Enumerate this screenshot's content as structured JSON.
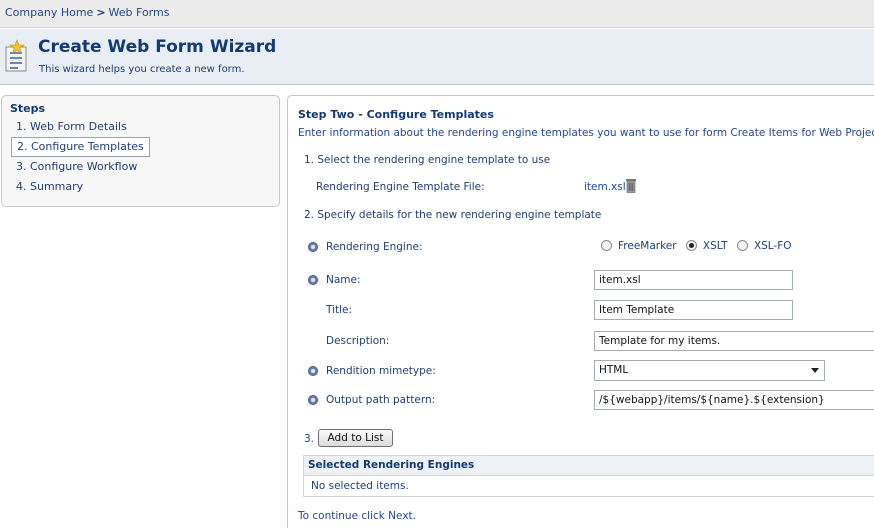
{
  "breadcrumb": {
    "home": "Company Home",
    "separator": ">",
    "current": "Web Forms"
  },
  "header": {
    "icon": "wizard-form-icon",
    "title": "Create Web Form Wizard",
    "subtitle": "This wizard helps you create a new form."
  },
  "steps": {
    "title": "Steps",
    "items": [
      {
        "label": "1. Web Form Details"
      },
      {
        "label": "2. Configure Templates"
      },
      {
        "label": "3. Configure Workflow"
      },
      {
        "label": "4. Summary"
      }
    ],
    "active_index": 1
  },
  "main": {
    "heading": "Step Two - Configure Templates",
    "intro": "Enter information about the rendering engine templates you want to use for form Create Items for Web Project.",
    "section1": "1. Select the rendering engine template to use",
    "template_file_label": "Rendering Engine Template File:",
    "template_file_value": "item.xsl",
    "section2": "2. Specify details for the new rendering engine template",
    "rendering_engine_label": "Rendering Engine:",
    "rendering_options": [
      "FreeMarker",
      "XSLT",
      "XSL-FO"
    ],
    "rendering_selected": "XSLT",
    "name_label": "Name:",
    "name_value": "item.xsl",
    "title_label": "Title:",
    "title_value": "Item Template",
    "description_label": "Description:",
    "description_value": "Template for my items.",
    "mimetype_label": "Rendition mimetype:",
    "mimetype_value": "HTML",
    "output_label": "Output path pattern:",
    "output_value": "/${webapp}/items/${name}.${extension}",
    "add_number": "3.",
    "add_button": "Add to List",
    "selected_engines_header": "Selected Rendering Engines",
    "selected_engines_empty": "No selected items.",
    "continue_note": "To continue click Next."
  },
  "colors": {
    "accent": "#133a77",
    "header_bg": "#e9edf4",
    "breadcrumb_bg": "#ececec"
  }
}
